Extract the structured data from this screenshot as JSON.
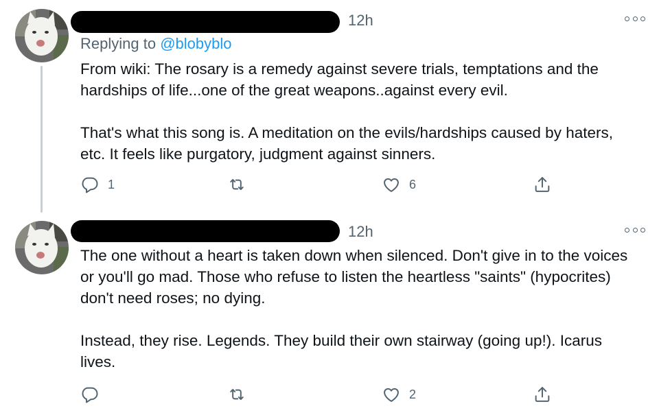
{
  "tweets": [
    {
      "time": "12h",
      "replying_prefix": "Replying to ",
      "replying_handle": "@blobyblo",
      "paragraphs": [
        "From wiki: The rosary is a remedy against severe trials, temptations and the hardships of life...one of the great weapons..against every evil.",
        "That's what this song is. A meditation on the evils/hardships caused by haters, etc. It feels like purgatory, judgment against sinners."
      ],
      "reply_count": "1",
      "retweet_count": "",
      "like_count": "6"
    },
    {
      "time": "12h",
      "paragraphs": [
        "The one without a heart is taken down when silenced. Don't give in to the voices or you'll go mad. Those who refuse to listen the heartless \"saints\" (hypocrites) don't need roses; no dying.",
        "Instead, they rise. Legends. They build their own stairway (going up!). Icarus lives."
      ],
      "reply_count": "",
      "retweet_count": "",
      "like_count": "2"
    }
  ],
  "icons": {
    "reply": "reply-icon",
    "retweet": "retweet-icon",
    "like": "heart-icon",
    "share": "share-icon",
    "more": "more-options-icon"
  },
  "colors": {
    "text": "#0f1419",
    "secondary": "#536471",
    "link": "#1d9bf0",
    "thread_line": "#c4cfd6",
    "redaction": "#000000"
  }
}
